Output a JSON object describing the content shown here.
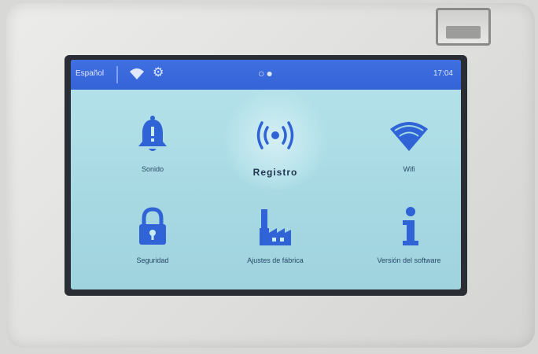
{
  "colors": {
    "status_bar": "#3a69dc",
    "screen_bg": "#aadbe4",
    "icon_blue": "#2f63d6",
    "label_text": "#284a66"
  },
  "status": {
    "language": "Español",
    "wifi_icon": "wifi-icon",
    "gear_icon": "gear-icon",
    "center_indicator": "○●",
    "time": "17:04"
  },
  "tiles": [
    {
      "label": "Sonido",
      "icon": "bell-icon"
    },
    {
      "label": "Registro",
      "icon": "wireless-signal-icon"
    },
    {
      "label": "Wifi",
      "icon": "wifi-icon"
    },
    {
      "label": "Seguridad",
      "icon": "lock-icon"
    },
    {
      "label": "Ajustes de fábrica",
      "icon": "factory-icon"
    },
    {
      "label": "Versión del software",
      "icon": "info-icon"
    }
  ]
}
